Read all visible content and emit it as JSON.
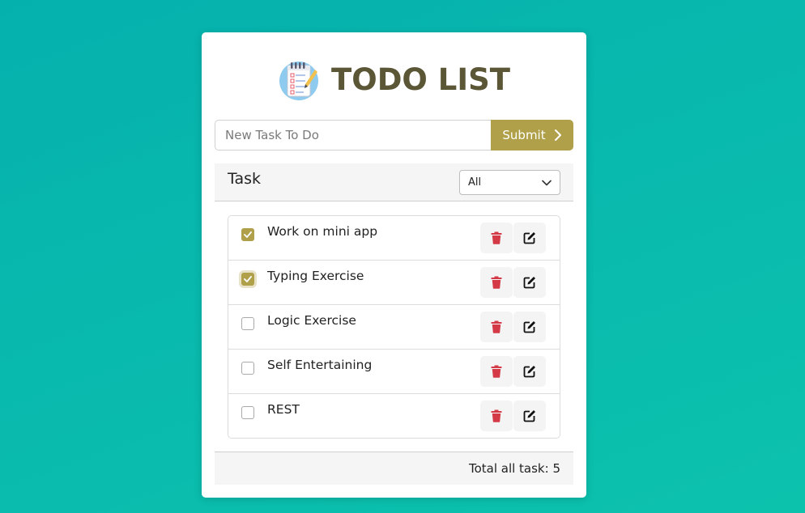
{
  "app": {
    "title": "TODO LIST",
    "logo_icon": "notepad-checklist-icon"
  },
  "new_task": {
    "placeholder": "New Task To Do",
    "value": "",
    "submit_label": "Submit"
  },
  "list_header": {
    "label": "Task",
    "filter_selected": "All"
  },
  "tasks": [
    {
      "label": "Work on mini app",
      "checked": true
    },
    {
      "label": "Typing Exercise",
      "checked": true
    },
    {
      "label": "Logic Exercise",
      "checked": false
    },
    {
      "label": "Self Entertaining",
      "checked": false
    },
    {
      "label": "REST",
      "checked": false
    }
  ],
  "footer": {
    "total_label": "Total all task: 5"
  },
  "colors": {
    "accent": "#b0a04a",
    "title": "#5b5636",
    "delete": "#d43a46",
    "background_start": "#05b1ad",
    "background_end": "#0cc2ad"
  }
}
